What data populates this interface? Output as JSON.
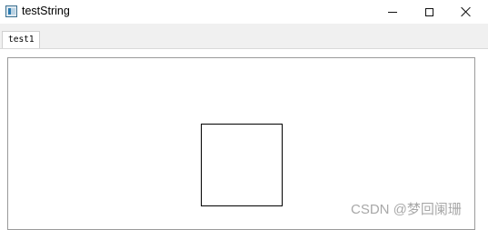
{
  "window": {
    "title": "testString",
    "controls": {
      "minimize": "minimize",
      "maximize": "maximize",
      "close": "close"
    }
  },
  "tabs": [
    {
      "label": "test1",
      "active": true
    }
  ],
  "watermark": "CSDN @梦回阑珊",
  "colors": {
    "frame_border": "#9a9a9a",
    "tabbar_bg": "#f0f0f0",
    "watermark": "#a8a8a8"
  }
}
